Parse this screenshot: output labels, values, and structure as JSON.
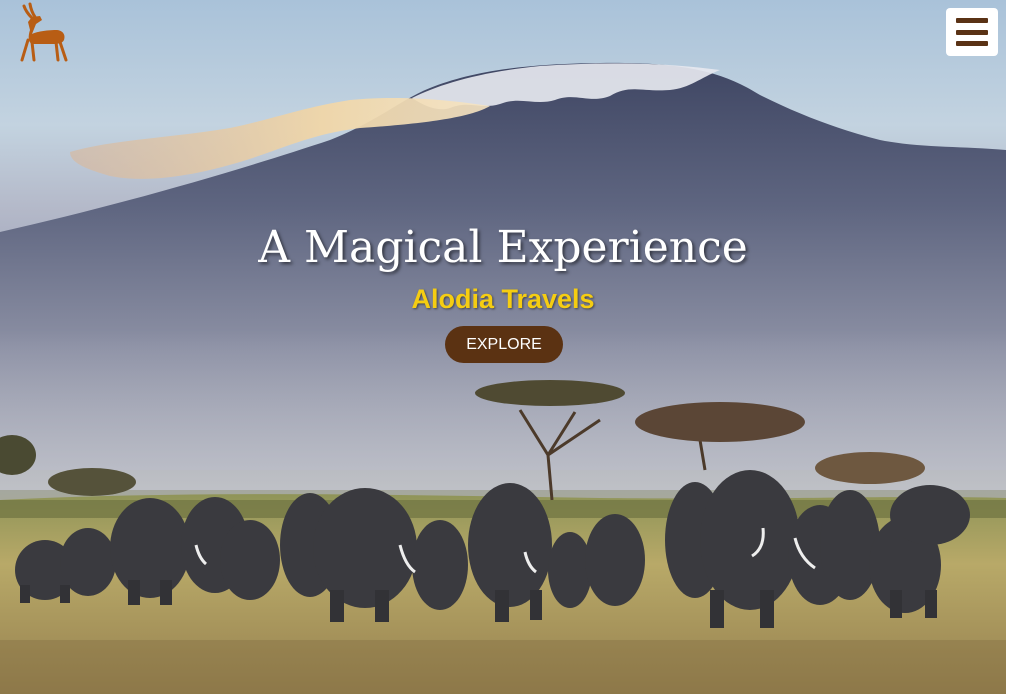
{
  "brand": {
    "logo_icon": "gazelle-icon",
    "logo_color": "#b85d14"
  },
  "header": {
    "menu_icon": "hamburger-menu-icon",
    "menu_color": "#5a3215"
  },
  "hero": {
    "title": "A Magical Experience",
    "subtitle": "Alodia Travels",
    "subtitle_color": "#f5cd12",
    "cta_label": "EXPLORE",
    "cta_color": "#5b3212",
    "background_image": "kilimanjaro-elephants-photo"
  }
}
